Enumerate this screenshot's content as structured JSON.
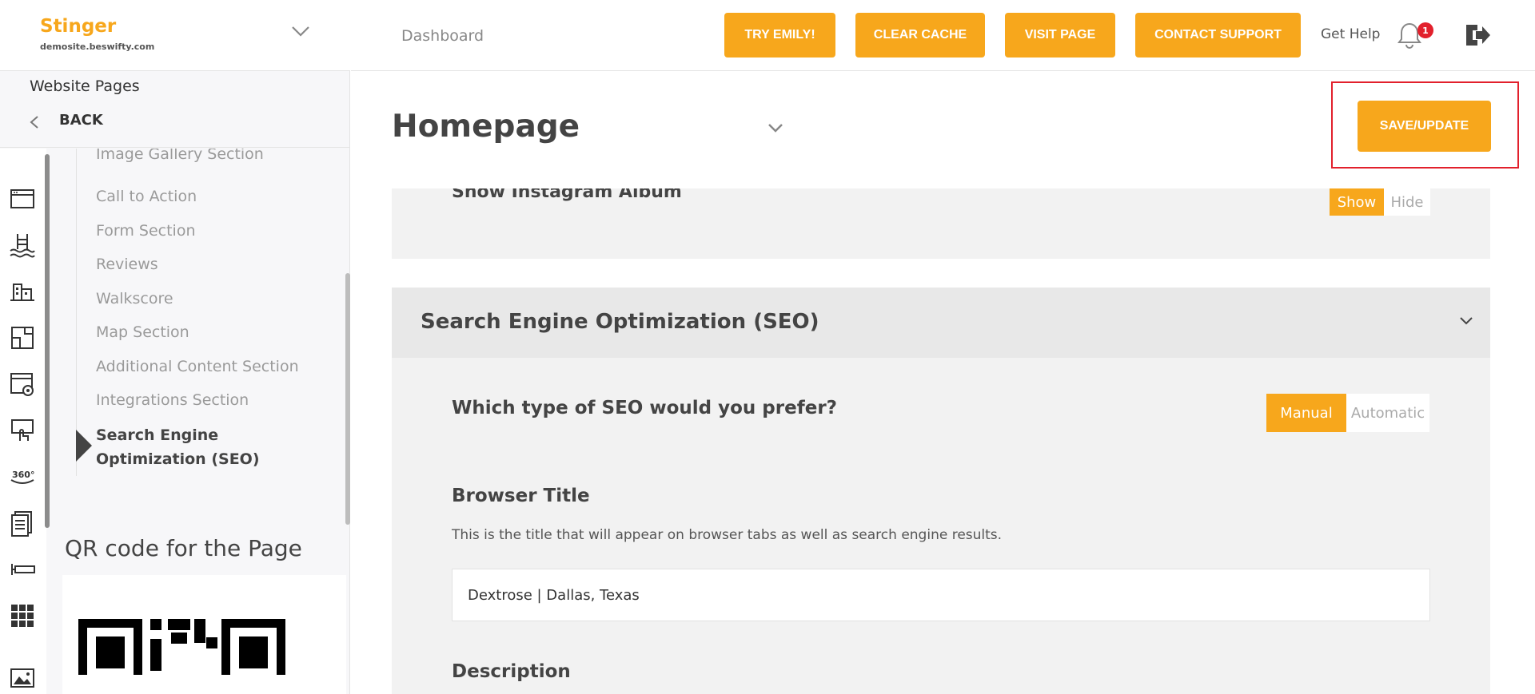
{
  "brand": {
    "name": "Stinger",
    "domain": "demosite.beswifty.com"
  },
  "sidebar": {
    "pages_title": "Website Pages",
    "back_label": "BACK",
    "sections": [
      "Image Gallery Section",
      "Call to Action",
      "Form Section",
      "Reviews",
      "Walkscore",
      "Map Section",
      "Additional Content Section",
      "Integrations Section"
    ],
    "active_section": "Search Engine Optimization (SEO)",
    "rail_icons": [
      "browser-window-icon",
      "pool-icon",
      "buildings-icon",
      "floorplan-icon",
      "browser-settings-icon",
      "touch-screen-icon",
      "360-view-icon",
      "document-icon",
      "ruler-icon",
      "grid-icon",
      "image-icon"
    ],
    "qr_title": "QR code for the Page"
  },
  "header": {
    "breadcrumb": "Dashboard",
    "buttons": [
      "TRY EMILY!",
      "CLEAR CACHE",
      "VISIT PAGE",
      "CONTACT SUPPORT"
    ],
    "get_help": "Get Help",
    "notification_count": "1"
  },
  "page": {
    "title": "Homepage",
    "save_label": "SAVE/UPDATE"
  },
  "instagram": {
    "label": "Show Instagram Album",
    "show": "Show",
    "hide": "Hide",
    "selected": "Show"
  },
  "seo": {
    "title": "Search Engine Optimization (SEO)",
    "question": "Which type of SEO would you prefer?",
    "options": [
      "Manual",
      "Automatic"
    ],
    "selected": "Manual",
    "browser_title_label": "Browser Title",
    "browser_title_help": "This is the title that will appear on browser tabs as well as search engine results.",
    "browser_title_value": "Dextrose | Dallas, Texas",
    "description_label": "Description"
  },
  "colors": {
    "accent": "#f7a71c",
    "alert": "#e2202c"
  }
}
